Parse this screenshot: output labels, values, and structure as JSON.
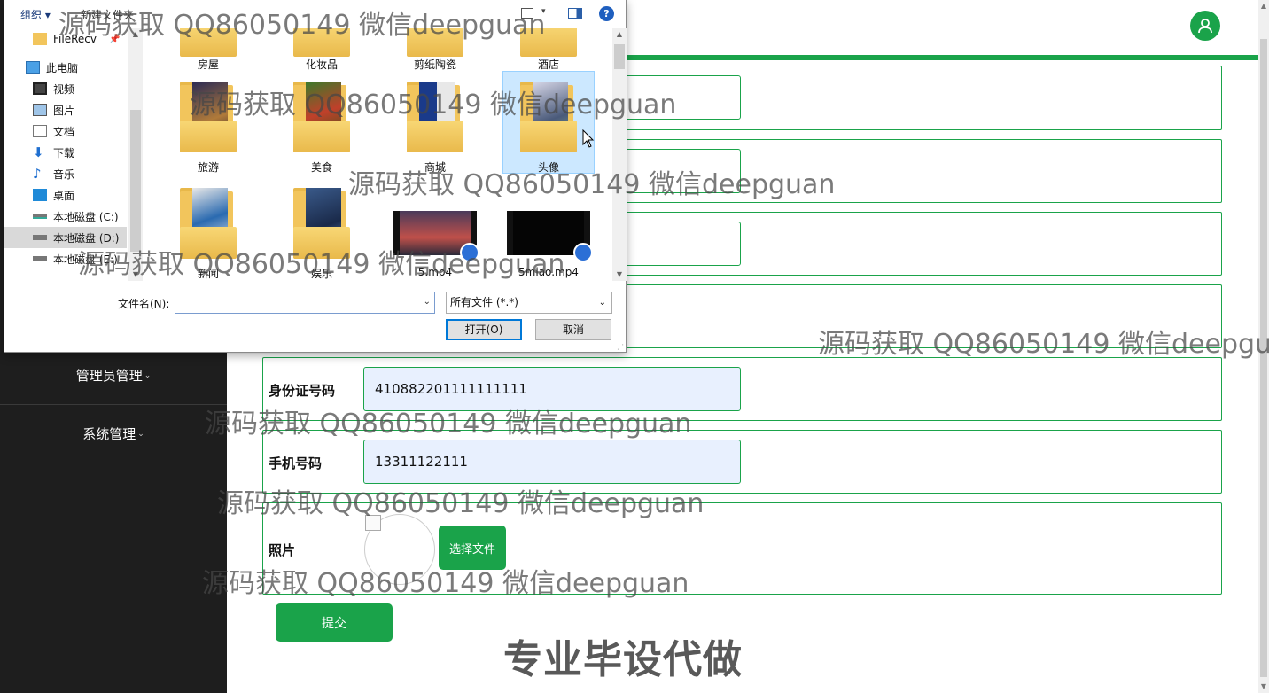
{
  "colors": {
    "accent": "#1aa34a",
    "sidebar_bg": "#1e1e1e"
  },
  "sidebar": {
    "items": [
      {
        "label": "管理员管理"
      },
      {
        "label": "系统管理"
      }
    ]
  },
  "form": {
    "id_card": {
      "label": "身份证号码",
      "value": "410882201111111111"
    },
    "phone": {
      "label": "手机号码",
      "value": "13311122111"
    },
    "photo": {
      "label": "照片",
      "choose_button": "选择文件"
    },
    "submit": "提交"
  },
  "dialog": {
    "toolbar": {
      "organize": "组织 ▾",
      "new_folder": "新建文件夹"
    },
    "nav": [
      {
        "label": "FileRecv",
        "icon": "folder-icon"
      },
      {
        "label": "此电脑",
        "icon": "computer-icon"
      },
      {
        "label": "视频",
        "icon": "video-library-icon"
      },
      {
        "label": "图片",
        "icon": "picture-library-icon"
      },
      {
        "label": "文档",
        "icon": "document-library-icon"
      },
      {
        "label": "下载",
        "icon": "download-icon"
      },
      {
        "label": "音乐",
        "icon": "music-icon"
      },
      {
        "label": "桌面",
        "icon": "desktop-icon"
      },
      {
        "label": "本地磁盘 (C:)",
        "icon": "drive-icon"
      },
      {
        "label": "本地磁盘 (D:)",
        "icon": "drive-icon"
      },
      {
        "label": "本地磁盘 (E:)",
        "icon": "drive-icon"
      }
    ],
    "files": [
      {
        "name": "房屋",
        "type": "folder"
      },
      {
        "name": "化妆品",
        "type": "folder"
      },
      {
        "name": "剪纸陶瓷",
        "type": "folder"
      },
      {
        "name": "酒店",
        "type": "folder"
      },
      {
        "name": "旅游",
        "type": "folder"
      },
      {
        "name": "美食",
        "type": "folder"
      },
      {
        "name": "商城",
        "type": "folder"
      },
      {
        "name": "头像",
        "type": "folder",
        "selected": true
      },
      {
        "name": "新闻",
        "type": "folder"
      },
      {
        "name": "娱乐",
        "type": "folder"
      },
      {
        "name": "5.mp4",
        "type": "video"
      },
      {
        "name": "5miao.mp4",
        "type": "video"
      }
    ],
    "filename_label": "文件名(N):",
    "filename_value": "",
    "filetype": "所有文件 (*.*)",
    "open_button": "打开(O)",
    "cancel_button": "取消"
  },
  "watermarks": {
    "text": "源码获取 QQ86050149 微信deepguan",
    "big": "专业毕设代做"
  }
}
